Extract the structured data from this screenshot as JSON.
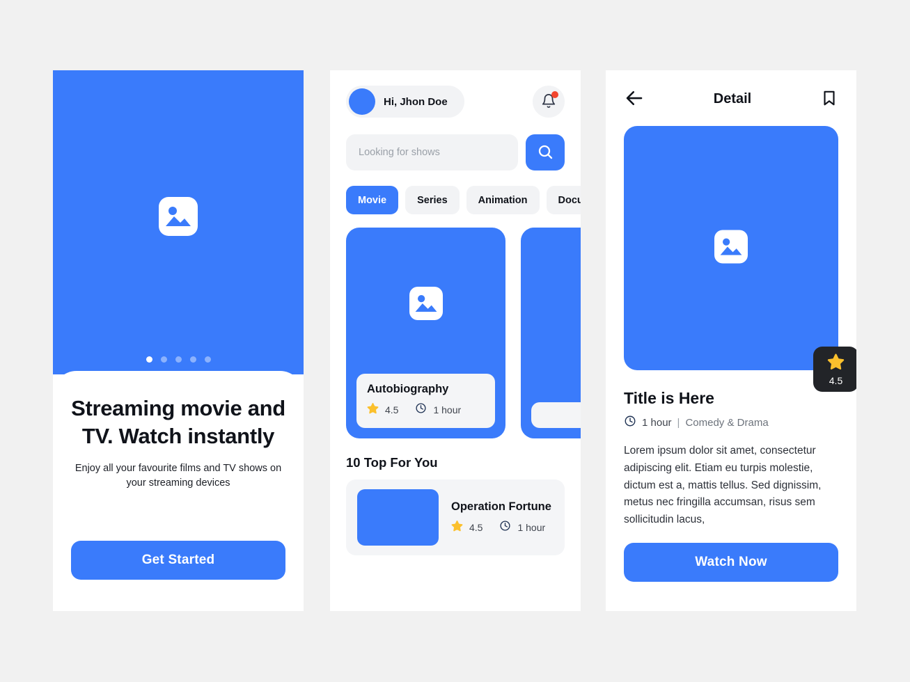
{
  "theme": {
    "primary_blue": "#3a7bfb",
    "page_background": "#f1f1f1",
    "surface": "#ffffff",
    "muted_surface": "#f2f3f5",
    "star_gold": "#fbc02d",
    "badge_dark": "#222428",
    "notification_red": "#f2452e",
    "text_dark": "#10131a"
  },
  "onboarding": {
    "image_placeholder": "image-placeholder-icon",
    "pager": {
      "total": 5,
      "active_index": 0
    },
    "headline": "Streaming movie and TV. Watch instantly",
    "subtext": "Enjoy all your favourite films and TV shows on your streaming devices",
    "cta_label": "Get Started"
  },
  "home": {
    "greeting": "Hi, Jhon Doe",
    "avatar": "user-avatar",
    "notification": {
      "icon": "bell-icon",
      "has_unread": true
    },
    "search": {
      "placeholder": "Looking for shows",
      "value": "",
      "button_icon": "search-icon"
    },
    "categories": [
      {
        "label": "Movie",
        "active": true
      },
      {
        "label": "Series",
        "active": false
      },
      {
        "label": "Animation",
        "active": false
      },
      {
        "label": "Docum",
        "active": false
      }
    ],
    "featured": [
      {
        "title": "Autobiography",
        "rating": "4.5",
        "duration": "1 hour",
        "image_placeholder": "image-placeholder-icon"
      },
      {
        "title": "",
        "rating": "",
        "duration": "",
        "image_placeholder": "image-placeholder-icon"
      }
    ],
    "top_section_title": "10 Top For You",
    "top_items": [
      {
        "title": "Operation Fortune",
        "rating": "4.5",
        "duration": "1 hour"
      }
    ]
  },
  "detail": {
    "back_icon": "arrow-left-icon",
    "title": "Detail",
    "bookmark_icon": "bookmark-icon",
    "poster_placeholder": "image-placeholder-icon",
    "rating_badge": {
      "icon": "star-icon",
      "value": "4.5"
    },
    "movie_title": "Title is Here",
    "duration": "1 hour",
    "separator": "|",
    "genre": "Comedy & Drama",
    "description": "Lorem ipsum dolor sit amet, consectetur adipiscing elit. Etiam eu turpis molestie, dictum est a, mattis tellus. Sed dignissim, metus nec fringilla accumsan, risus sem sollicitudin lacus,",
    "cta_label": "Watch Now"
  }
}
